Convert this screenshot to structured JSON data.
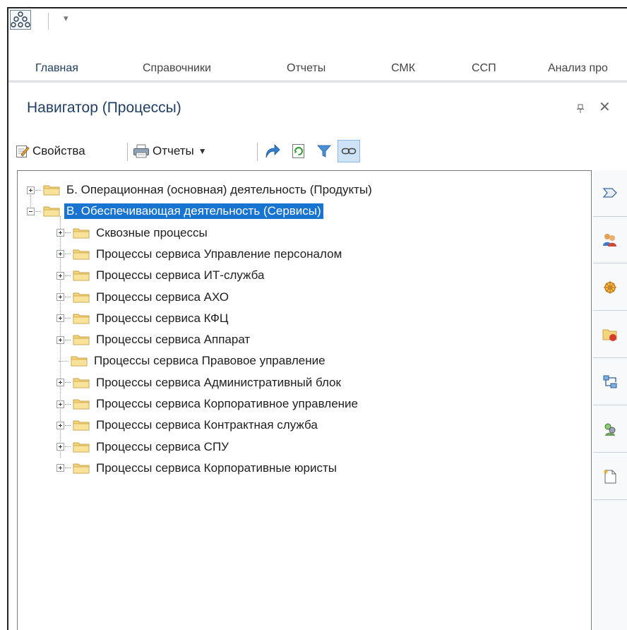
{
  "ribbon": {
    "tabs": [
      {
        "label": "Главная",
        "active": true
      },
      {
        "label": "Справочники"
      },
      {
        "label": "Отчеты"
      },
      {
        "label": "СМК"
      },
      {
        "label": "ССП"
      },
      {
        "label": "Анализ про"
      }
    ]
  },
  "panel": {
    "title": "Навигатор (Процессы)"
  },
  "toolbar": {
    "properties_label": "Свойства",
    "reports_label": "Отчеты"
  },
  "tree": {
    "nodes": [
      {
        "label": "Б. Операционная (основная) деятельность (Продукты)",
        "level": 0,
        "expander": "plus"
      },
      {
        "label": "В. Обеспечивающая деятельность (Сервисы)",
        "level": 0,
        "expander": "minus",
        "selected": true
      },
      {
        "label": "Сквозные процессы",
        "level": 1,
        "expander": "plus"
      },
      {
        "label": "Процессы сервиса Управление персоналом",
        "level": 1,
        "expander": "plus"
      },
      {
        "label": "Процессы сервиса ИТ-служба",
        "level": 1,
        "expander": "plus"
      },
      {
        "label": "Процессы сервиса АХО",
        "level": 1,
        "expander": "plus"
      },
      {
        "label": "Процессы сервиса КФЦ",
        "level": 1,
        "expander": "plus"
      },
      {
        "label": "Процессы сервиса Аппарат",
        "level": 1,
        "expander": "plus"
      },
      {
        "label": "Процессы сервиса Правовое управление",
        "level": 1,
        "expander": "none"
      },
      {
        "label": "Процессы сервиса Административный блок",
        "level": 1,
        "expander": "plus"
      },
      {
        "label": "Процессы сервиса Корпоративное управление",
        "level": 1,
        "expander": "plus"
      },
      {
        "label": "Процессы сервиса Контрактная служба",
        "level": 1,
        "expander": "plus"
      },
      {
        "label": "Процессы сервиса СПУ",
        "level": 1,
        "expander": "plus"
      },
      {
        "label": "Процессы сервиса Корпоративные юристы",
        "level": 1,
        "expander": "plus"
      }
    ]
  },
  "sidebar": {
    "buttons": [
      {
        "icon": "process-arrow-icon"
      },
      {
        "icon": "users-group-icon"
      },
      {
        "icon": "wheel-icon"
      },
      {
        "icon": "folder-shield-icon"
      },
      {
        "icon": "hierarchy-icon"
      },
      {
        "icon": "roles-icon"
      },
      {
        "icon": "new-document-icon"
      }
    ]
  },
  "colors": {
    "selection": "#1874d1",
    "title": "#1f3f64",
    "folder": "#f5d57a"
  }
}
